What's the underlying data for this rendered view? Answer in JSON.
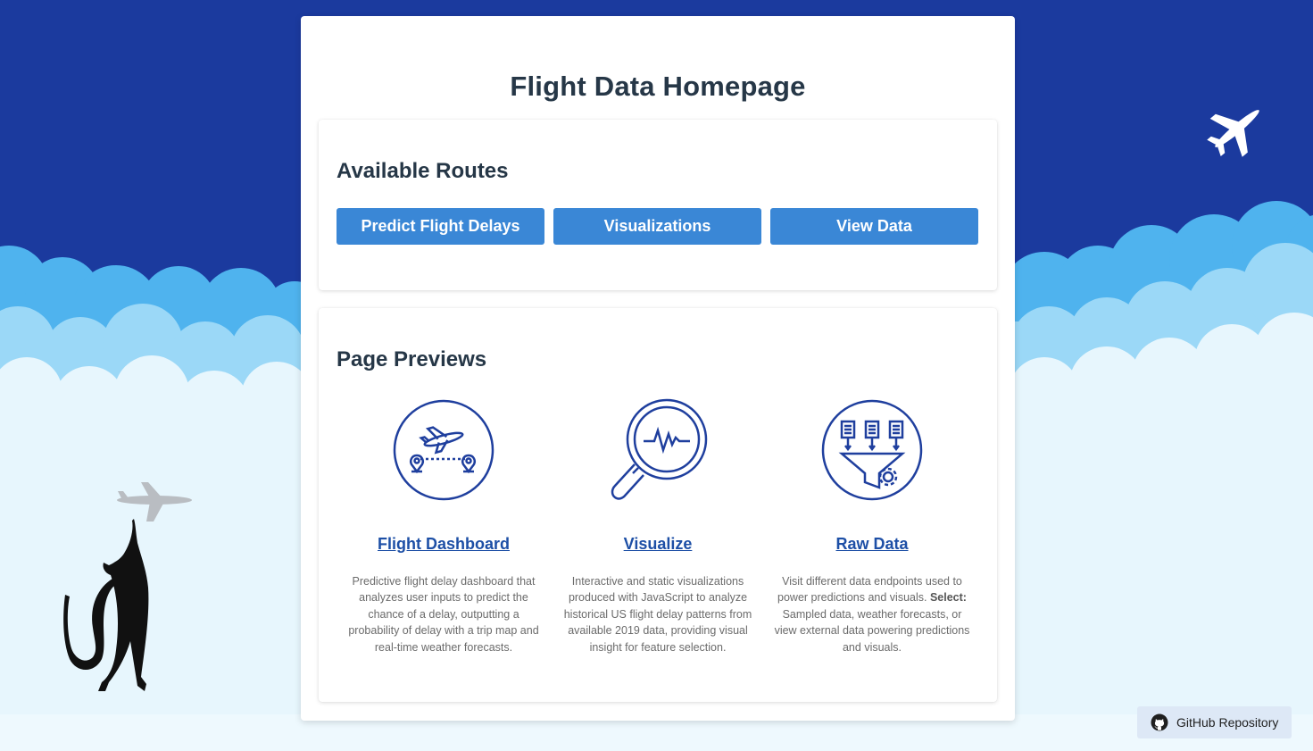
{
  "page": {
    "title": "Flight Data Homepage"
  },
  "routes": {
    "heading": "Available Routes",
    "buttons": [
      {
        "label": "Predict Flight Delays"
      },
      {
        "label": "Visualizations"
      },
      {
        "label": "View Data"
      }
    ]
  },
  "previews": {
    "heading": "Page Previews",
    "items": [
      {
        "icon": "airplane-route-icon",
        "link": "Flight Dashboard",
        "description": "Predictive flight delay dashboard that analyzes user inputs to predict the chance of a delay, outputting a probability of delay with a trip map and real-time weather forecasts."
      },
      {
        "icon": "magnifier-pulse-icon",
        "link": "Visualize",
        "description": "Interactive and static visualizations produced with JavaScript to analyze historical US flight delay patterns from available 2019 data, providing visual insight for feature selection."
      },
      {
        "icon": "data-funnel-icon",
        "link": "Raw Data",
        "description_intro": "Visit different data endpoints used to power predictions and visuals.",
        "description_bold": "Select:",
        "description_rest": " Sampled data, weather forecasts, or view external data powering predictions and visuals."
      }
    ]
  },
  "footer": {
    "github_label": "GitHub Repository"
  },
  "colors": {
    "sky": "#1b3a9e",
    "button": "#3a87d6",
    "heading": "#263747",
    "link": "#1d4fa6",
    "icon": "#1f3f9e"
  }
}
